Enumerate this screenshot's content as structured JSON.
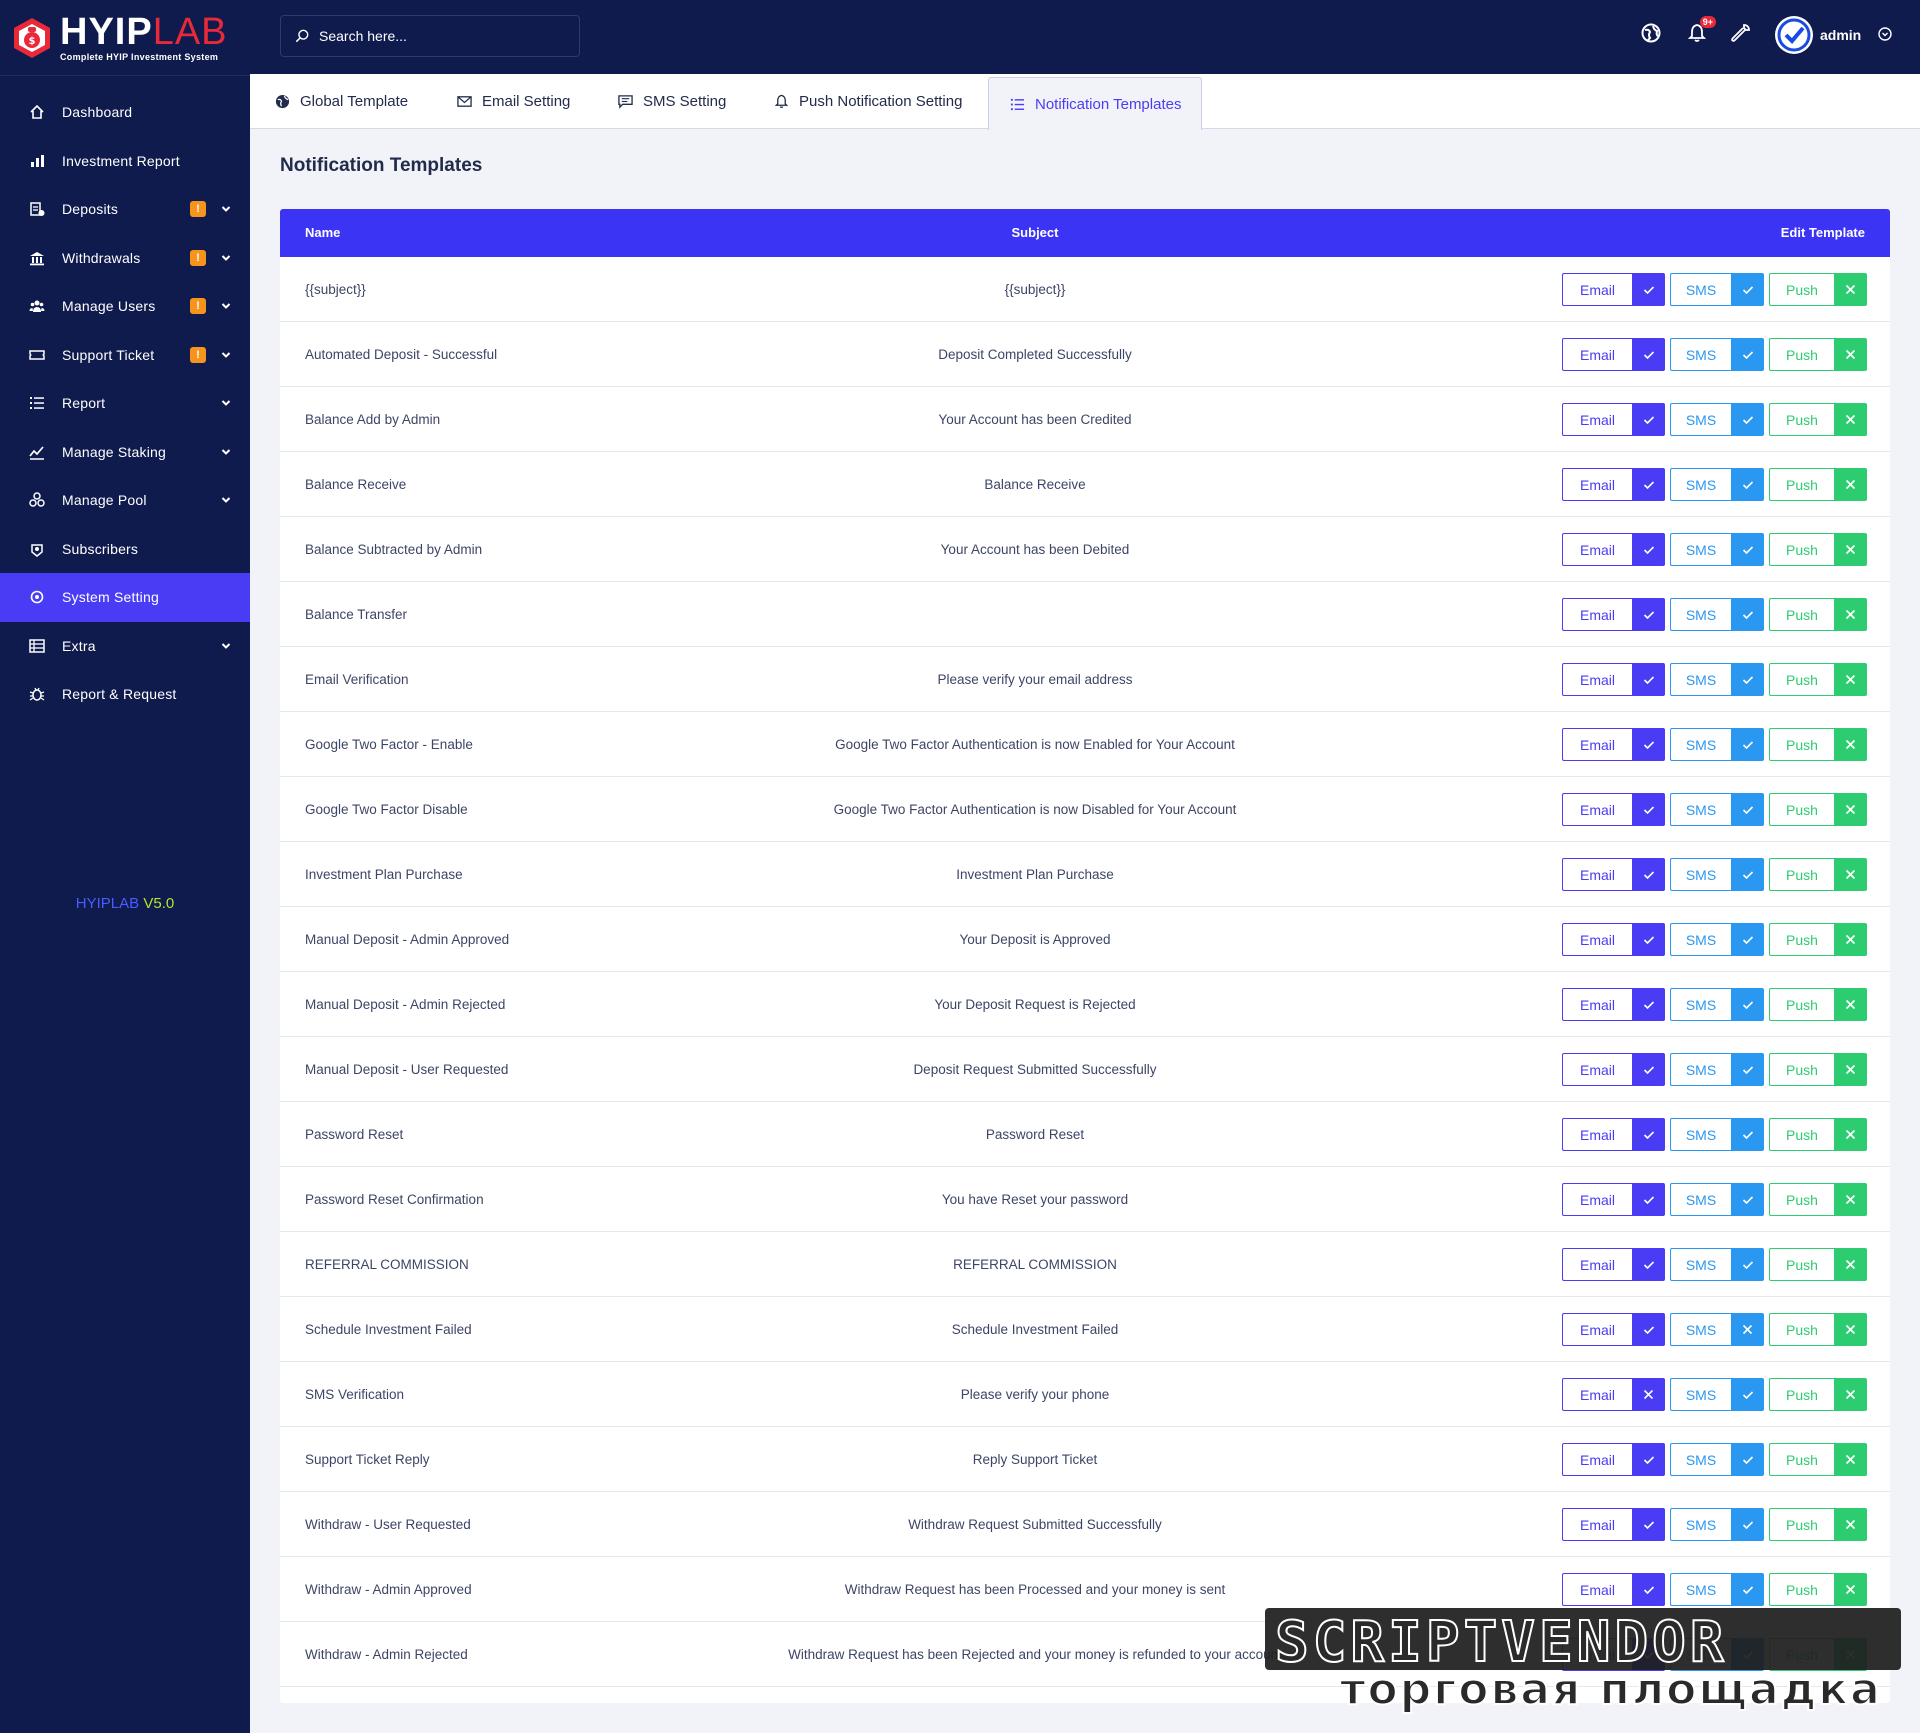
{
  "brand": {
    "word1": "HYIP",
    "word2": "LAB",
    "tagline": "Complete HYIP Investment System"
  },
  "version": {
    "name": "HYIPLAB",
    "number": "V5.0"
  },
  "search": {
    "placeholder": "Search here..."
  },
  "header": {
    "notification_count": "9+",
    "admin_name": "admin"
  },
  "sidebar": {
    "items": [
      {
        "label": "Dashboard",
        "icon": "home-icon",
        "badge": "",
        "chevron": false,
        "active": false
      },
      {
        "label": "Investment Report",
        "icon": "bar-chart-icon",
        "badge": "",
        "chevron": false,
        "active": false
      },
      {
        "label": "Deposits",
        "icon": "deposit-icon",
        "badge": "!",
        "chevron": true,
        "active": false
      },
      {
        "label": "Withdrawals",
        "icon": "bank-icon",
        "badge": "!",
        "chevron": true,
        "active": false
      },
      {
        "label": "Manage Users",
        "icon": "users-icon",
        "badge": "!",
        "chevron": true,
        "active": false
      },
      {
        "label": "Support Ticket",
        "icon": "ticket-icon",
        "badge": "!",
        "chevron": true,
        "active": false
      },
      {
        "label": "Report",
        "icon": "list-icon",
        "badge": "",
        "chevron": true,
        "active": false
      },
      {
        "label": "Manage Staking",
        "icon": "staking-icon",
        "badge": "",
        "chevron": true,
        "active": false
      },
      {
        "label": "Manage Pool",
        "icon": "pool-icon",
        "badge": "",
        "chevron": true,
        "active": false
      },
      {
        "label": "Subscribers",
        "icon": "subscribers-icon",
        "badge": "",
        "chevron": false,
        "active": false
      },
      {
        "label": "System Setting",
        "icon": "settings-icon",
        "badge": "",
        "chevron": false,
        "active": true
      },
      {
        "label": "Extra",
        "icon": "server-icon",
        "badge": "",
        "chevron": true,
        "active": false
      },
      {
        "label": "Report & Request",
        "icon": "bug-icon",
        "badge": "",
        "chevron": false,
        "active": false
      }
    ]
  },
  "tabs": [
    {
      "label": "Global Template",
      "icon": "globe-icon",
      "active": false
    },
    {
      "label": "Email Setting",
      "icon": "envelope-icon",
      "active": false
    },
    {
      "label": "SMS Setting",
      "icon": "message-icon",
      "active": false
    },
    {
      "label": "Push Notification Setting",
      "icon": "bell-icon",
      "active": false
    },
    {
      "label": "Notification Templates",
      "icon": "list-icon",
      "active": true
    }
  ],
  "page_title": "Notification Templates",
  "table": {
    "headers": {
      "name": "Name",
      "subject": "Subject",
      "edit": "Edit Template"
    },
    "button_labels": {
      "email": "Email",
      "sms": "SMS",
      "push": "Push"
    },
    "rows": [
      {
        "name": "{{subject}}",
        "subject": "{{subject}}",
        "email": true,
        "sms": true,
        "push": false
      },
      {
        "name": "Automated Deposit - Successful",
        "subject": "Deposit Completed Successfully",
        "email": true,
        "sms": true,
        "push": false
      },
      {
        "name": "Balance Add by Admin",
        "subject": "Your Account has been Credited",
        "email": true,
        "sms": true,
        "push": false
      },
      {
        "name": "Balance Receive",
        "subject": "Balance Receive",
        "email": true,
        "sms": true,
        "push": false
      },
      {
        "name": "Balance Subtracted by Admin",
        "subject": "Your Account has been Debited",
        "email": true,
        "sms": true,
        "push": false
      },
      {
        "name": "Balance Transfer",
        "subject": "",
        "email": true,
        "sms": true,
        "push": false
      },
      {
        "name": "Email Verification",
        "subject": "Please verify your email address",
        "email": true,
        "sms": true,
        "push": false
      },
      {
        "name": "Google Two Factor - Enable",
        "subject": "Google Two Factor Authentication is now Enabled for Your Account",
        "email": true,
        "sms": true,
        "push": false
      },
      {
        "name": "Google Two Factor Disable",
        "subject": "Google Two Factor Authentication is now Disabled for Your Account",
        "email": true,
        "sms": true,
        "push": false
      },
      {
        "name": "Investment Plan Purchase",
        "subject": "Investment Plan Purchase",
        "email": true,
        "sms": true,
        "push": false
      },
      {
        "name": "Manual Deposit - Admin Approved",
        "subject": "Your Deposit is Approved",
        "email": true,
        "sms": true,
        "push": false
      },
      {
        "name": "Manual Deposit - Admin Rejected",
        "subject": "Your Deposit Request is Rejected",
        "email": true,
        "sms": true,
        "push": false
      },
      {
        "name": "Manual Deposit - User Requested",
        "subject": "Deposit Request Submitted Successfully",
        "email": true,
        "sms": true,
        "push": false
      },
      {
        "name": "Password Reset",
        "subject": "Password Reset",
        "email": true,
        "sms": true,
        "push": false
      },
      {
        "name": "Password Reset Confirmation",
        "subject": "You have Reset your password",
        "email": true,
        "sms": true,
        "push": false
      },
      {
        "name": "REFERRAL COMMISSION",
        "subject": "REFERRAL COMMISSION",
        "email": true,
        "sms": true,
        "push": false
      },
      {
        "name": "Schedule Investment Failed",
        "subject": "Schedule Investment Failed",
        "email": true,
        "sms": false,
        "push": false
      },
      {
        "name": "SMS Verification",
        "subject": "Please verify your phone",
        "email": false,
        "sms": true,
        "push": false
      },
      {
        "name": "Support Ticket Reply",
        "subject": "Reply Support Ticket",
        "email": true,
        "sms": true,
        "push": false
      },
      {
        "name": "Withdraw  - User Requested",
        "subject": "Withdraw Request Submitted Successfully",
        "email": true,
        "sms": true,
        "push": false
      },
      {
        "name": "Withdraw - Admin  Approved",
        "subject": "Withdraw Request has been Processed and your money is sent",
        "email": true,
        "sms": true,
        "push": false
      },
      {
        "name": "Withdraw - Admin Rejected",
        "subject": "Withdraw Request has been Rejected and your money is refunded to your account",
        "email": true,
        "sms": true,
        "push": false
      }
    ]
  },
  "watermark": {
    "line1": "SCRIPTVENDOR",
    "line2": "торговая площадка"
  },
  "colors": {
    "sidebar_bg": "#0f1a4d",
    "accent": "#4a3cf4",
    "table_header": "#3c34f5",
    "sms": "#2a97f0",
    "push": "#2ecc71",
    "badge": "#f7941d",
    "brand_red": "#e8293a"
  }
}
